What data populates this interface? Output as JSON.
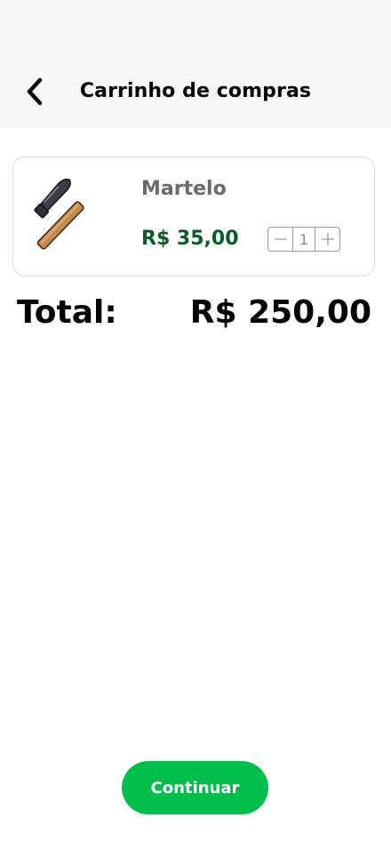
{
  "header": {
    "title": "Carrinho de compras",
    "back_icon": "chevron-left-icon"
  },
  "cart": {
    "items": [
      {
        "name": "Martelo",
        "price": "R$ 35,00",
        "quantity": "1",
        "image_icon": "hammer-icon",
        "decrement_icon": "minus-icon",
        "increment_icon": "plus-icon"
      }
    ]
  },
  "summary": {
    "total_label": "Total:",
    "total_value": "R$ 250,00"
  },
  "actions": {
    "continue_label": "Continuar"
  },
  "colors": {
    "header_background": "#f7f7f7",
    "price_green": "#0b5a2a",
    "button_green": "#00c04b"
  }
}
